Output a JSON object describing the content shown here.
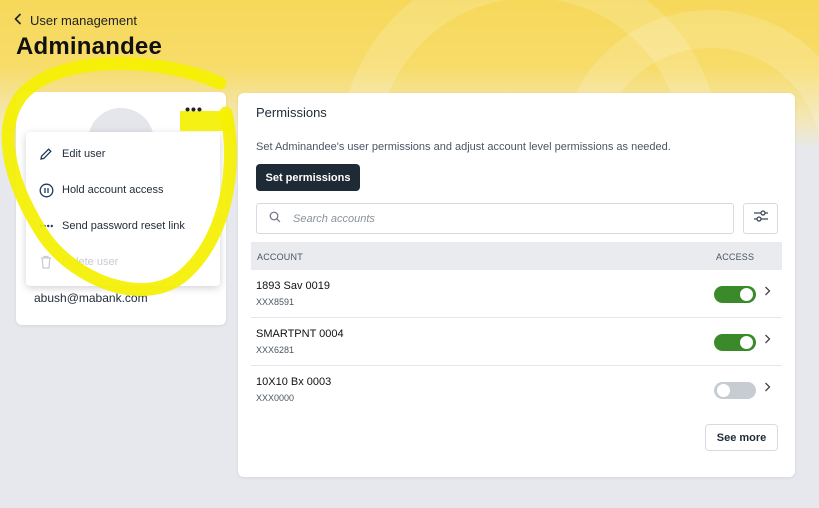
{
  "header": {
    "back_label": "User management",
    "title": "Adminandee"
  },
  "user_card": {
    "more_icon": "ellipsis-icon",
    "email": "abush@mabank.com"
  },
  "menu": {
    "items": [
      {
        "label": "Edit user",
        "icon": "pencil-icon",
        "disabled": false
      },
      {
        "label": "Hold account access",
        "icon": "pause-icon",
        "disabled": false
      },
      {
        "label": "Send password reset link",
        "icon": "password-dots-icon",
        "disabled": false
      },
      {
        "label": "Delete user",
        "icon": "trash-icon",
        "disabled": true
      }
    ]
  },
  "permissions": {
    "title": "Permissions",
    "description": "Set Adminandee's user permissions and adjust account level permissions as needed.",
    "set_button": "Set permissions",
    "search_placeholder": "Search accounts",
    "columns": {
      "account": "ACCOUNT",
      "access": "ACCESS"
    },
    "accounts": [
      {
        "name": "1893 Sav 0019",
        "number": "XXX8591",
        "access": true
      },
      {
        "name": "SMARTPNT 0004",
        "number": "XXX6281",
        "access": true
      },
      {
        "name": "10X10 Bx 0003",
        "number": "XXX0000",
        "access": false
      }
    ],
    "see_more": "See more"
  },
  "colors": {
    "brand_yellow": "#f6d85a",
    "toggle_on": "#3a8a2a",
    "toggle_off": "#c7cbd2",
    "primary_button": "#1e2a36",
    "annotation": "#f5f000"
  }
}
